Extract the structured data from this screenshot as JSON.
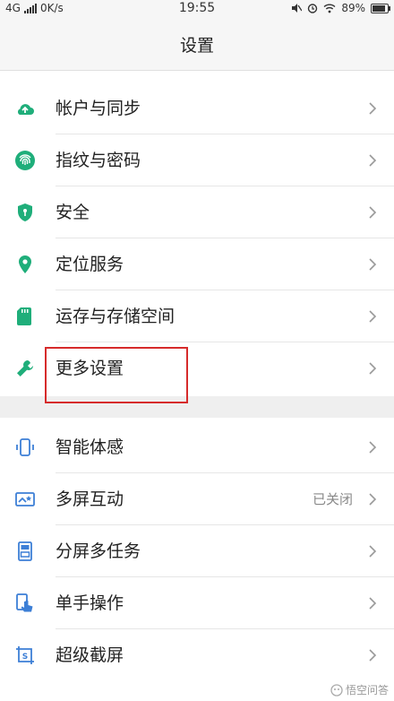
{
  "status_bar": {
    "network": "4G",
    "speed": "0K/s",
    "time": "19:55",
    "battery_percent": "89%",
    "battery_level": 0.89
  },
  "header": {
    "title": "设置"
  },
  "groups": [
    {
      "items": [
        {
          "label": "帐户与同步",
          "icon": "cloud-icon"
        },
        {
          "label": "指纹与密码",
          "icon": "fingerprint-icon"
        },
        {
          "label": "安全",
          "icon": "shield-icon"
        },
        {
          "label": "定位服务",
          "icon": "location-pin-icon"
        },
        {
          "label": "运存与存储空间",
          "icon": "sd-card-icon"
        },
        {
          "label": "更多设置",
          "icon": "wrench-icon"
        }
      ]
    },
    {
      "items": [
        {
          "label": "智能体感",
          "icon": "phone-gesture-icon"
        },
        {
          "label": "多屏互动",
          "icon": "cast-screen-icon",
          "value": "已关闭"
        },
        {
          "label": "分屏多任务",
          "icon": "split-screen-icon"
        },
        {
          "label": "单手操作",
          "icon": "one-hand-icon"
        },
        {
          "label": "超级截屏",
          "icon": "screenshot-icon"
        }
      ]
    }
  ],
  "colors": {
    "accent_green": "#1fae7a",
    "accent_blue": "#3d7fd6",
    "highlight_red": "#d62b2b"
  },
  "watermark": "悟空问答"
}
